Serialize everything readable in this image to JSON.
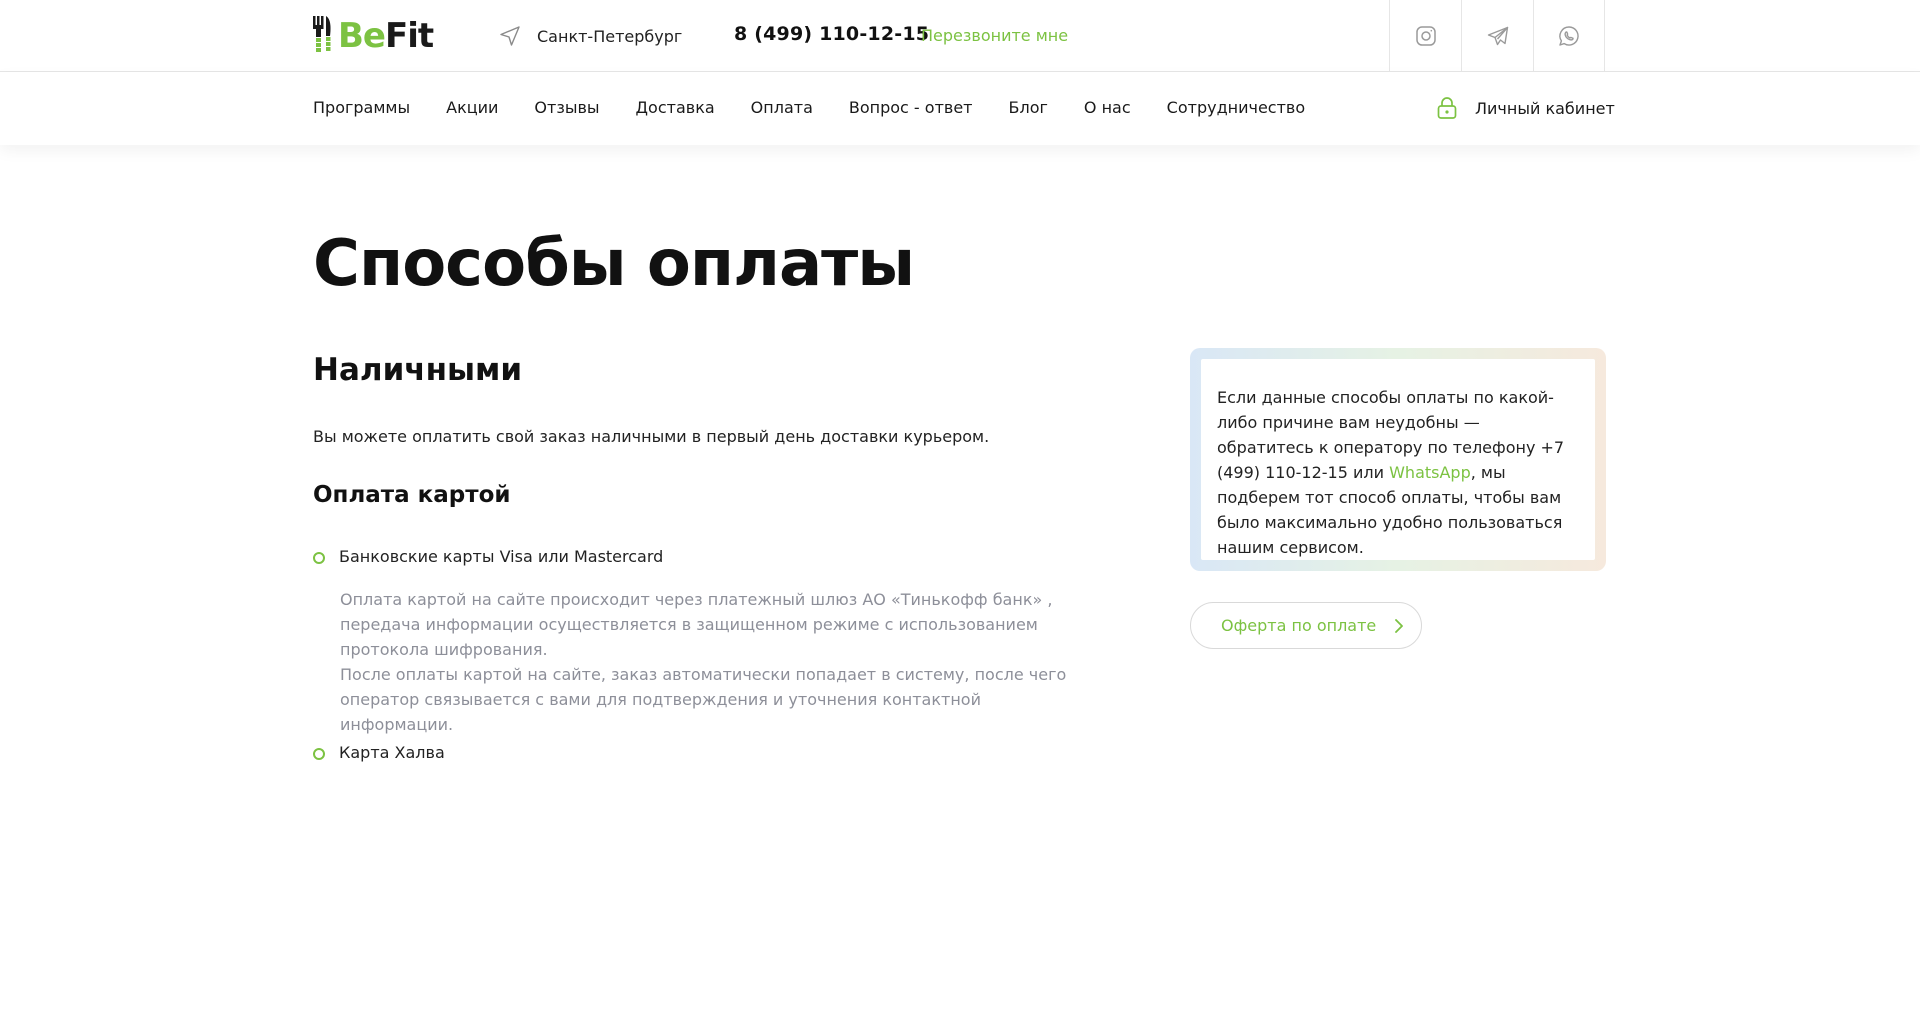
{
  "header": {
    "logo": {
      "part1": "Be",
      "part2": "Fit",
      "icon": "fork-knife-icon"
    },
    "city": {
      "label": "Санкт-Петербург",
      "icon": "location-arrow-icon"
    },
    "phone": "8 (499) 110-12-15",
    "callback_label": "Перезвоните мне",
    "socials": [
      {
        "name": "instagram",
        "icon": "instagram-icon"
      },
      {
        "name": "telegram",
        "icon": "telegram-icon"
      },
      {
        "name": "whatsapp",
        "icon": "whatsapp-icon"
      }
    ]
  },
  "nav": {
    "items": [
      "Программы",
      "Акции",
      "Отзывы",
      "Доставка",
      "Оплата",
      "Вопрос - ответ",
      "Блог",
      "О нас",
      "Сотрудничество"
    ],
    "account_label": "Личный кабинет",
    "account_icon": "lock-icon"
  },
  "main": {
    "title": "Способы оплаты",
    "cash": {
      "heading": "Наличными",
      "text": "Вы можете оплатить свой заказ наличными в первый день доставки курьером."
    },
    "card": {
      "heading": "Оплата картой",
      "items": [
        {
          "label": "Банковские карты Visa или Mastercard",
          "desc_1": "Оплата картой на сайте происходит через платежный шлюз АО «Тинькофф банк» , передача информации осуществляется в защищенном режиме с использованием протокола шифрования.",
          "desc_2": "После оплаты картой на сайте, заказ автоматически попадает в систему, после чего оператор связывается с вами для подтверждения и уточнения контактной информации."
        },
        {
          "label": "Карта Халва"
        }
      ]
    }
  },
  "aside": {
    "info_before": "Если данные способы оплаты по какой-либо причине вам неудобны — обратитесь к оператору по телефону +7 (499) 110-12-15 или ",
    "info_link": "WhatsApp",
    "info_after": ", мы подберем тот способ оплаты, чтобы вам было максимально удобно пользоваться нашим сервисом.",
    "offer_button": "Оферта по оплате"
  },
  "colors": {
    "accent": "#7cc242",
    "muted_text": "#8d8f99",
    "border": "#e6e6e6"
  }
}
